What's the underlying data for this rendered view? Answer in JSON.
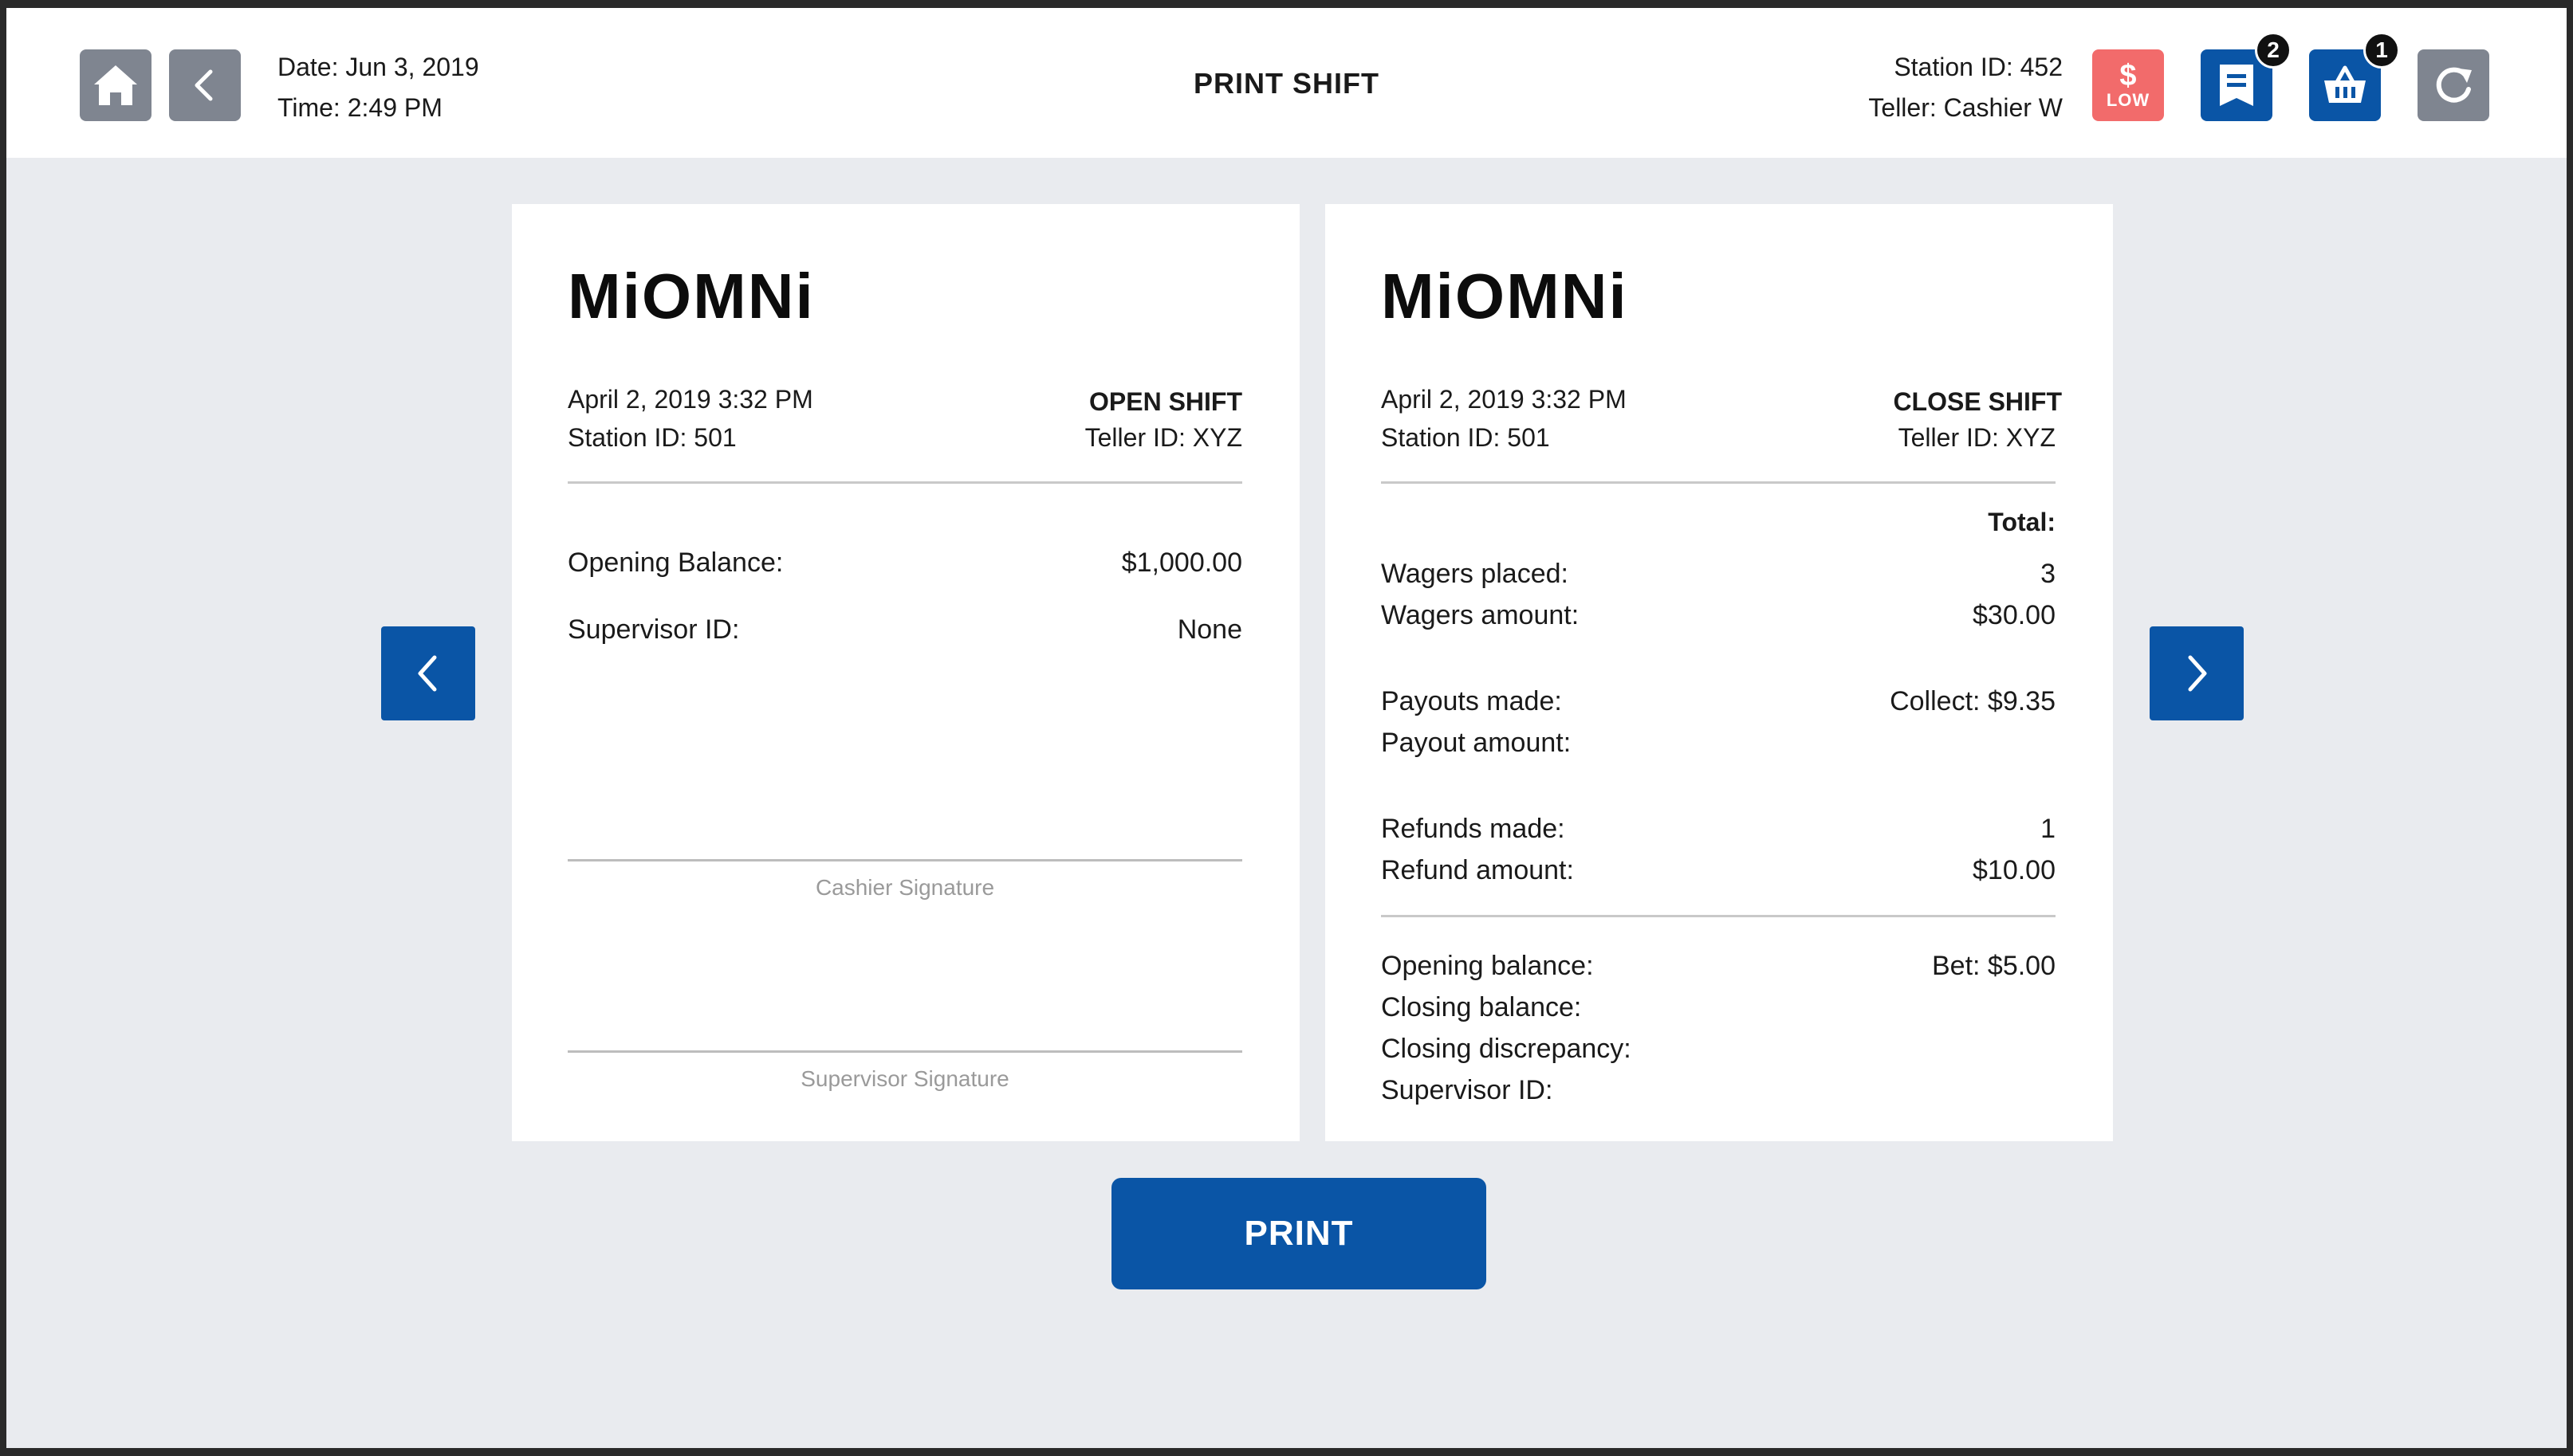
{
  "header": {
    "title": "PRINT SHIFT",
    "date": "Date: Jun 3, 2019",
    "time": "Time: 2:49 PM",
    "station": "Station ID: 452",
    "teller": "Teller: Cashier W",
    "cash_status": {
      "symbol": "$",
      "label": "LOW",
      "color": "#f26b6b"
    },
    "receipts_badge": "2",
    "basket_badge": "1",
    "accent_color": "#0a55a6"
  },
  "open_shift": {
    "logo": "MiOMNi",
    "datetime": "April 2, 2019 3:32 PM",
    "station": "Station ID: 501",
    "title": "OPEN SHIFT",
    "teller": "Teller ID: XYZ",
    "rows": [
      {
        "label": "Opening Balance:",
        "value": "$1,000.00"
      },
      {
        "label": "Supervisor ID:",
        "value": "None"
      }
    ],
    "cashier_signature": "Cashier Signature",
    "supervisor_signature": "Supervisor Signature"
  },
  "close_shift": {
    "logo": "MiOMNi",
    "datetime": "April 2, 2019 3:32 PM",
    "station": "Station ID: 501",
    "title": "CLOSE SHIFT",
    "teller": "Teller ID: XYZ",
    "total_header": "Total:",
    "groups": [
      [
        {
          "label": "Wagers placed:",
          "value": "3"
        },
        {
          "label": "Wagers amount:",
          "value": "$30.00"
        }
      ],
      [
        {
          "label": "Payouts made:",
          "value": "Collect: $9.35"
        },
        {
          "label": "Payout amount:",
          "value": ""
        }
      ],
      [
        {
          "label": "Refunds made:",
          "value": "1"
        },
        {
          "label": "Refund amount:",
          "value": "$10.00"
        }
      ],
      [
        {
          "label": "Opening balance:",
          "value": "Bet: $5.00"
        },
        {
          "label": "Closing balance:",
          "value": ""
        },
        {
          "label": "Closing discrepancy:",
          "value": ""
        },
        {
          "label": "Supervisor ID:",
          "value": ""
        }
      ]
    ]
  },
  "actions": {
    "print_label": "PRINT"
  }
}
